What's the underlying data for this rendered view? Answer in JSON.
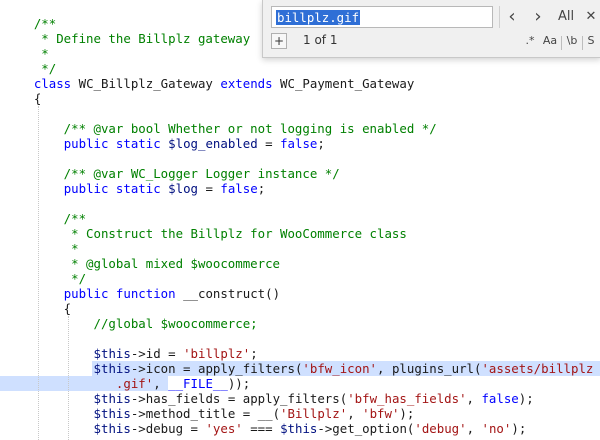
{
  "find": {
    "query": "billplz.gif",
    "count": "1 of 1",
    "prev_icon": "‹",
    "next_icon": "›",
    "all_label": "All",
    "close_icon": "✕",
    "add_icon": "+",
    "regex_label": ".*",
    "case_label": "Aa",
    "word_label": "\\b",
    "selection_label": "S"
  },
  "colors": {
    "comment": "#008000",
    "keyword": "#0000ff",
    "string": "#a31515",
    "variable": "#001080",
    "highlight": "#cfe0ff"
  },
  "code": {
    "lines": [
      [
        {
          "t": "    /**",
          "c": "comment"
        }
      ],
      [
        {
          "t": "     * Define the Billplz gateway",
          "c": "comment"
        }
      ],
      [
        {
          "t": "     *",
          "c": "comment"
        }
      ],
      [
        {
          "t": "     */",
          "c": "comment"
        }
      ],
      [
        {
          "t": "    ",
          "c": "plain"
        },
        {
          "t": "class",
          "c": "keyword"
        },
        {
          "t": " WC_Billplz_Gateway ",
          "c": "plain"
        },
        {
          "t": "extends",
          "c": "keyword"
        },
        {
          "t": " WC_Payment_Gateway",
          "c": "plain"
        }
      ],
      [
        {
          "t": "    {",
          "c": "plain"
        }
      ],
      [
        {
          "t": "",
          "c": "plain"
        }
      ],
      [
        {
          "t": "        /** @var bool Whether or not logging is enabled */",
          "c": "comment"
        }
      ],
      [
        {
          "t": "        ",
          "c": "plain"
        },
        {
          "t": "public",
          "c": "keyword"
        },
        {
          "t": " ",
          "c": "plain"
        },
        {
          "t": "static",
          "c": "keyword"
        },
        {
          "t": " ",
          "c": "plain"
        },
        {
          "t": "$log_enabled",
          "c": "var"
        },
        {
          "t": " = ",
          "c": "plain"
        },
        {
          "t": "false",
          "c": "keyword"
        },
        {
          "t": ";",
          "c": "plain"
        }
      ],
      [
        {
          "t": "",
          "c": "plain"
        }
      ],
      [
        {
          "t": "        /** @var WC_Logger Logger instance */",
          "c": "comment"
        }
      ],
      [
        {
          "t": "        ",
          "c": "plain"
        },
        {
          "t": "public",
          "c": "keyword"
        },
        {
          "t": " ",
          "c": "plain"
        },
        {
          "t": "static",
          "c": "keyword"
        },
        {
          "t": " ",
          "c": "plain"
        },
        {
          "t": "$log",
          "c": "var"
        },
        {
          "t": " = ",
          "c": "plain"
        },
        {
          "t": "false",
          "c": "keyword"
        },
        {
          "t": ";",
          "c": "plain"
        }
      ],
      [
        {
          "t": "",
          "c": "plain"
        }
      ],
      [
        {
          "t": "        /**",
          "c": "comment"
        }
      ],
      [
        {
          "t": "         * Construct the Billplz for WooCommerce class",
          "c": "comment"
        }
      ],
      [
        {
          "t": "         *",
          "c": "comment"
        }
      ],
      [
        {
          "t": "         * @global mixed $woocommerce",
          "c": "comment"
        }
      ],
      [
        {
          "t": "         */",
          "c": "comment"
        }
      ],
      [
        {
          "t": "        ",
          "c": "plain"
        },
        {
          "t": "public",
          "c": "keyword"
        },
        {
          "t": " ",
          "c": "plain"
        },
        {
          "t": "function",
          "c": "keyword"
        },
        {
          "t": " __construct()",
          "c": "plain"
        }
      ],
      [
        {
          "t": "        {",
          "c": "plain"
        }
      ],
      [
        {
          "t": "            //global $woocommerce;",
          "c": "comment"
        }
      ],
      [
        {
          "t": "",
          "c": "plain"
        }
      ],
      [
        {
          "t": "            ",
          "c": "plain"
        },
        {
          "t": "$this",
          "c": "var"
        },
        {
          "t": "->id = ",
          "c": "plain"
        },
        {
          "t": "'billplz'",
          "c": "string"
        },
        {
          "t": ";",
          "c": "plain"
        }
      ],
      [
        {
          "t": "            ",
          "c": "plain"
        },
        {
          "t": "$this",
          "c": "var"
        },
        {
          "t": "->icon = apply_filters(",
          "c": "plain"
        },
        {
          "t": "'bfw_icon'",
          "c": "string"
        },
        {
          "t": ", plugins_url(",
          "c": "plain"
        },
        {
          "t": "'assets/billplz",
          "c": "string"
        }
      ],
      [
        {
          "t": "               ",
          "c": "plain"
        },
        {
          "t": ".gif'",
          "c": "string"
        },
        {
          "t": ", ",
          "c": "plain"
        },
        {
          "t": "__FILE__",
          "c": "keyword"
        },
        {
          "t": "));",
          "c": "plain"
        }
      ],
      [
        {
          "t": "            ",
          "c": "plain"
        },
        {
          "t": "$this",
          "c": "var"
        },
        {
          "t": "->has_fields = apply_filters(",
          "c": "plain"
        },
        {
          "t": "'bfw_has_fields'",
          "c": "string"
        },
        {
          "t": ", ",
          "c": "plain"
        },
        {
          "t": "false",
          "c": "keyword"
        },
        {
          "t": ");",
          "c": "plain"
        }
      ],
      [
        {
          "t": "            ",
          "c": "plain"
        },
        {
          "t": "$this",
          "c": "var"
        },
        {
          "t": "->method_title = __(",
          "c": "plain"
        },
        {
          "t": "'Billplz'",
          "c": "string"
        },
        {
          "t": ", ",
          "c": "plain"
        },
        {
          "t": "'bfw'",
          "c": "string"
        },
        {
          "t": ");",
          "c": "plain"
        }
      ],
      [
        {
          "t": "            ",
          "c": "plain"
        },
        {
          "t": "$this",
          "c": "var"
        },
        {
          "t": "->debug = ",
          "c": "plain"
        },
        {
          "t": "'yes'",
          "c": "string"
        },
        {
          "t": " === ",
          "c": "plain"
        },
        {
          "t": "$this",
          "c": "var"
        },
        {
          "t": "->get_option(",
          "c": "plain"
        },
        {
          "t": "'debug'",
          "c": "string"
        },
        {
          "t": ", ",
          "c": "plain"
        },
        {
          "t": "'no'",
          "c": "string"
        },
        {
          "t": ");",
          "c": "plain"
        }
      ]
    ]
  }
}
